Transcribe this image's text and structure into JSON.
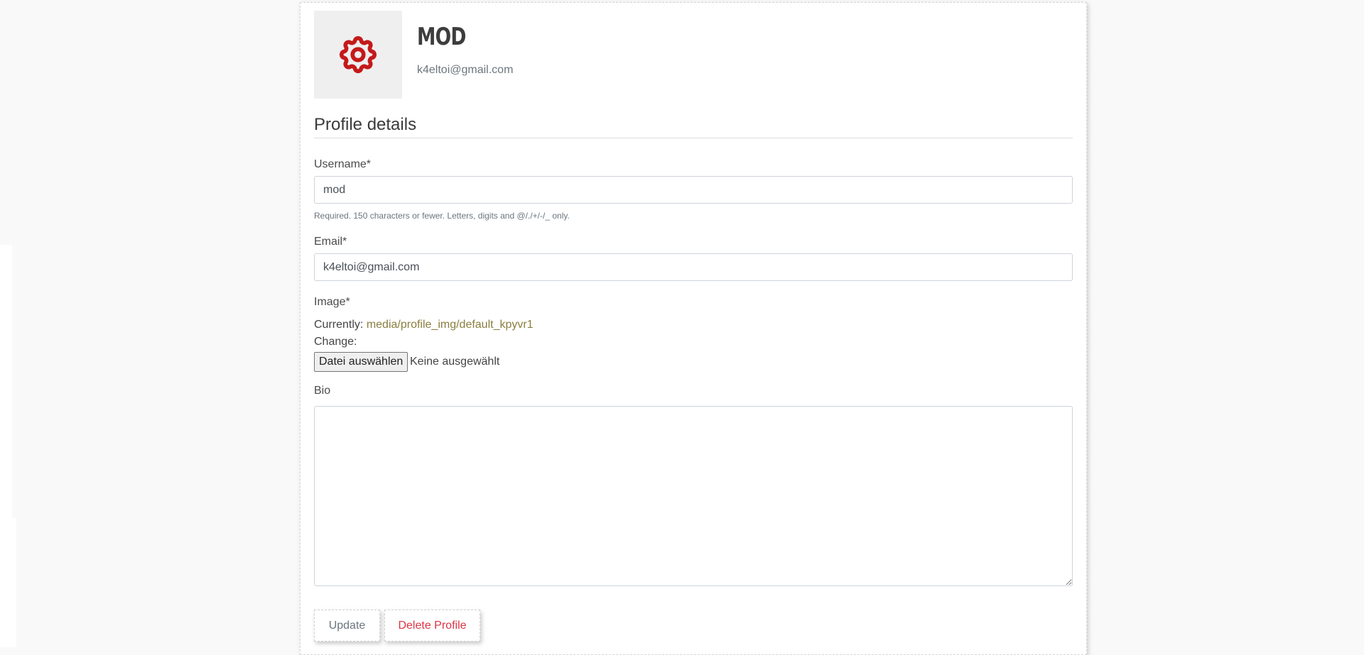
{
  "profile": {
    "name": "MOD",
    "email": "k4eltoi@gmail.com",
    "avatar_icon": "gear-icon",
    "avatar_icon_color": "#c41a1a"
  },
  "form": {
    "section_title": "Profile details",
    "username": {
      "label": "Username*",
      "value": "mod",
      "help": "Required. 150 characters or fewer. Letters, digits and @/./+/-/_ only."
    },
    "email": {
      "label": "Email*",
      "value": "k4eltoi@gmail.com"
    },
    "image": {
      "label": "Image*",
      "currently_label": "Currently:",
      "current_path": "media/profile_img/default_kpyvr1",
      "change_label": "Change:",
      "choose_button": "Datei auswählen",
      "no_file_text": "Keine ausgewählt"
    },
    "bio": {
      "label": "Bio",
      "value": ""
    }
  },
  "actions": {
    "update_label": "Update",
    "delete_label": "Delete Profile"
  },
  "colors": {
    "link": "#8a7e3f",
    "danger": "#dc3545",
    "muted": "#6c757d"
  }
}
